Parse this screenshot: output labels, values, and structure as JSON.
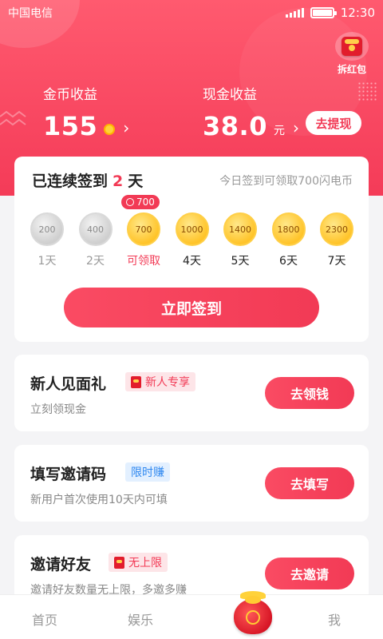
{
  "status_bar": {
    "carrier": "中国电信",
    "time": "12:30"
  },
  "header": {
    "red_packet_label": "拆红包",
    "coin_earnings": {
      "label": "金币收益",
      "value": "155"
    },
    "cash_earnings": {
      "label": "现金收益",
      "value": "38.0",
      "unit": "元"
    },
    "withdraw_label": "去提现"
  },
  "signin": {
    "title_prefix": "已连续签到",
    "streak_days": "2",
    "title_suffix": "天",
    "tip": "今日签到可领取700闪电币",
    "today_badge": "700",
    "days": [
      {
        "amount": "200",
        "label": "1天",
        "state": "past"
      },
      {
        "amount": "400",
        "label": "2天",
        "state": "past"
      },
      {
        "amount": "700",
        "label": "可领取",
        "state": "today"
      },
      {
        "amount": "1000",
        "label": "4天",
        "state": "future"
      },
      {
        "amount": "1400",
        "label": "5天",
        "state": "future"
      },
      {
        "amount": "1800",
        "label": "6天",
        "state": "future"
      },
      {
        "amount": "2300",
        "label": "7天",
        "state": "future"
      }
    ],
    "button_label": "立即签到"
  },
  "tasks": [
    {
      "title": "新人见面礼",
      "tag": "新人专享",
      "tag_style": "red",
      "subtitle": "立刻领现金",
      "button": "去领钱"
    },
    {
      "title": "填写邀请码",
      "tag": "限时赚",
      "tag_style": "blue",
      "subtitle": "新用户首次使用10天内可填",
      "button": "去填写"
    },
    {
      "title": "邀请好友",
      "tag": "无上限",
      "tag_style": "red",
      "subtitle": "邀请好友数量无上限，多邀多赚",
      "button": "去邀请"
    }
  ],
  "tab_bar": {
    "home": "首页",
    "entertainment": "娱乐",
    "me": "我"
  },
  "colors": {
    "primary": "#f23a55",
    "gold": "#ffc42a",
    "tag_blue": "#2f88f0"
  }
}
